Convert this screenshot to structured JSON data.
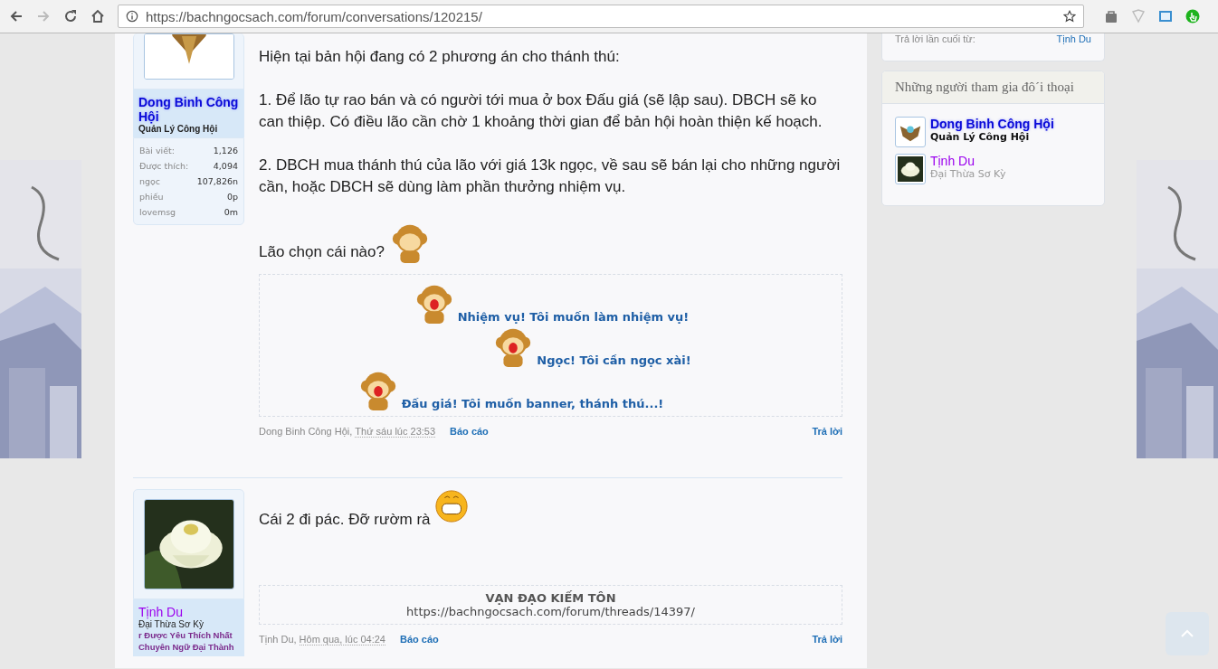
{
  "browser": {
    "url": "https://bachngocsach.com/forum/conversations/120215/"
  },
  "posts": [
    {
      "user": {
        "name": "Dong Binh Công Hội",
        "kind": "admin",
        "title": "Quản Lý Công Hội",
        "stats": [
          {
            "label": "Bài viết:",
            "value": "1,126"
          },
          {
            "label": "Được thích:",
            "value": "4,094"
          },
          {
            "label": "ngọc",
            "value": "107,826n"
          },
          {
            "label": "phiếu",
            "value": "0p"
          },
          {
            "label": "lovemsg",
            "value": "0m"
          }
        ]
      },
      "paragraphs": [
        {
          "text": "Hiện tại bản hội đang có 2 phương án cho thánh thú:",
          "kind": "plain"
        },
        {
          "text": "1. Để lão tự rao bán và có người tới mua ở box Đấu giá (sẽ lập sau). DBCH sẽ ko can thiệp. Có điều lão cần chờ 1 khoảng thời gian để bản hội hoàn thiện kế hoạch.",
          "kind": "plain"
        },
        {
          "text": "2. DBCH mua thánh thú của lão với giá 13k ngọc, về sau sẽ bán lại cho những người cần, hoặc DBCH sẽ dùng làm phần thưởng nhiệm vụ.",
          "kind": "plain"
        },
        {
          "text": "Lão chọn cái nào?",
          "kind": "monkey"
        }
      ],
      "box": {
        "kind": "options",
        "lines": [
          "Nhiệm vụ! Tôi muốn làm nhiệm vụ!",
          "Ngọc! Tôi cần ngọc xài!",
          "Đấu giá! Tôi muốn banner, thánh thú...!"
        ]
      },
      "footer": {
        "author": "Dong Binh Công Hội,",
        "date": "Thứ sáu lúc 23:53",
        "report": "Báo cáo",
        "reply": "Trả lời"
      }
    },
    {
      "user": {
        "name": "Tịnh Du",
        "kind": "member",
        "title": "Đại Thừa Sơ Kỳ",
        "banners": [
          "r Được Yêu Thích Nhất",
          "Chuyên Ngữ Đại Thành"
        ]
      },
      "paragraphs": [
        {
          "text": "Cái 2 đi pác. Đỡ rườm rà",
          "kind": "grin"
        }
      ],
      "box": {
        "kind": "signature",
        "title": "VẠN ĐẠO KIẾM TÔN",
        "url": "https://bachngocsach.com/forum/threads/14397/"
      },
      "footer": {
        "author": "Tịnh Du,",
        "date": "Hôm qua, lúc 04:24",
        "report": "Báo cáo",
        "reply": "Trả lời"
      }
    }
  ],
  "sidebar": {
    "last_reply": {
      "label": "Trả lời lần cuối từ:",
      "name": "Tịnh Du"
    },
    "participants": {
      "title": "Những người tham gia đô´i thoại",
      "people": [
        {
          "name": "Dong Binh Công Hội",
          "kind": "admin",
          "title": "Quản Lý Công Hội"
        },
        {
          "name": "Tịnh Du",
          "kind": "member",
          "title": "Đại Thừa Sơ Kỳ"
        }
      ]
    }
  }
}
